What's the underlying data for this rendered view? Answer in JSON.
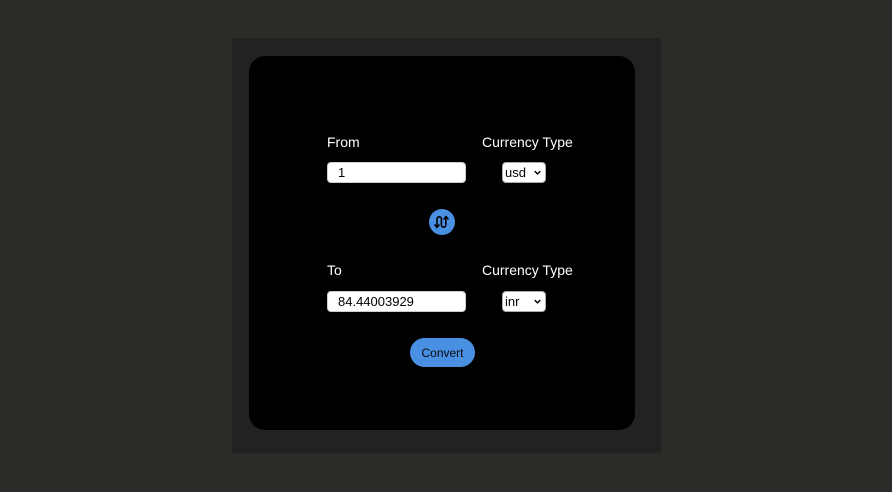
{
  "converter": {
    "from": {
      "label": "From",
      "value": "1",
      "currency_label": "Currency Type",
      "currency": "usd"
    },
    "to": {
      "label": "To",
      "value": "84.44003929",
      "currency_label": "Currency Type",
      "currency": "inr"
    },
    "swap_icon": "swap-arrows-icon",
    "convert_label": "Convert"
  },
  "colors": {
    "page_bg": "#2c2b27",
    "panel_bg": "#222222",
    "card_bg": "#000000",
    "accent": "#4a90e2",
    "text": "#ffffff"
  }
}
